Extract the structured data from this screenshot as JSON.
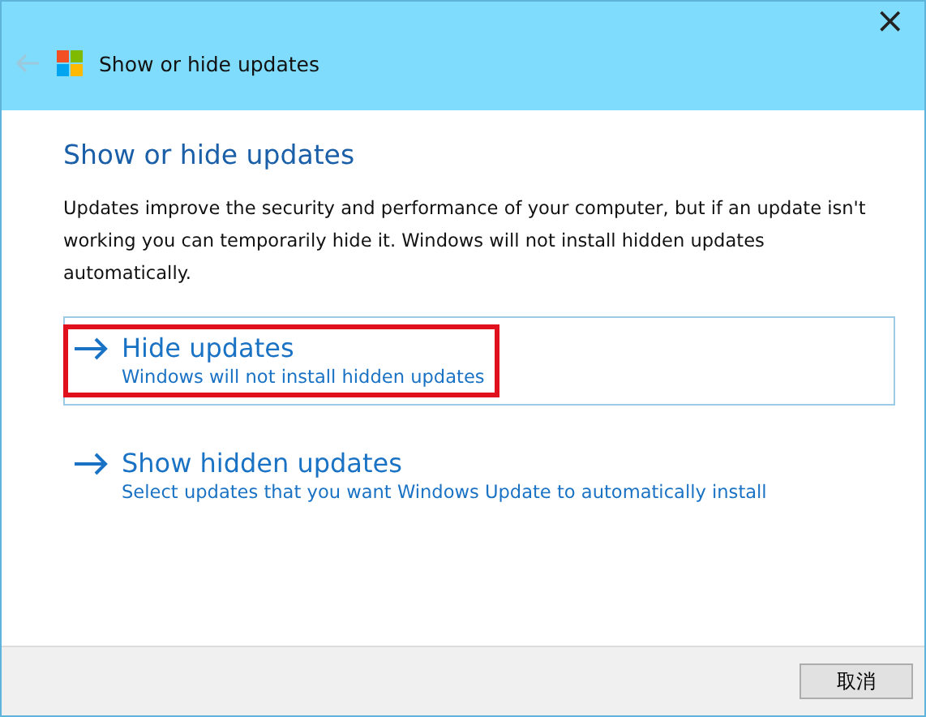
{
  "window": {
    "title": "Show or hide updates",
    "close": "×"
  },
  "heading": "Show or hide updates",
  "description": "Updates improve the security and performance of your computer, but if an update isn't working you can temporarily hide it. Windows will not install hidden updates automatically.",
  "options": [
    {
      "title": "Hide updates",
      "subtitle": "Windows will not install hidden updates",
      "selected": true,
      "highlighted": true
    },
    {
      "title": "Show hidden updates",
      "subtitle": "Select updates that you want Windows Update to automatically install",
      "selected": false,
      "highlighted": false
    }
  ],
  "buttons": [
    "取消"
  ]
}
